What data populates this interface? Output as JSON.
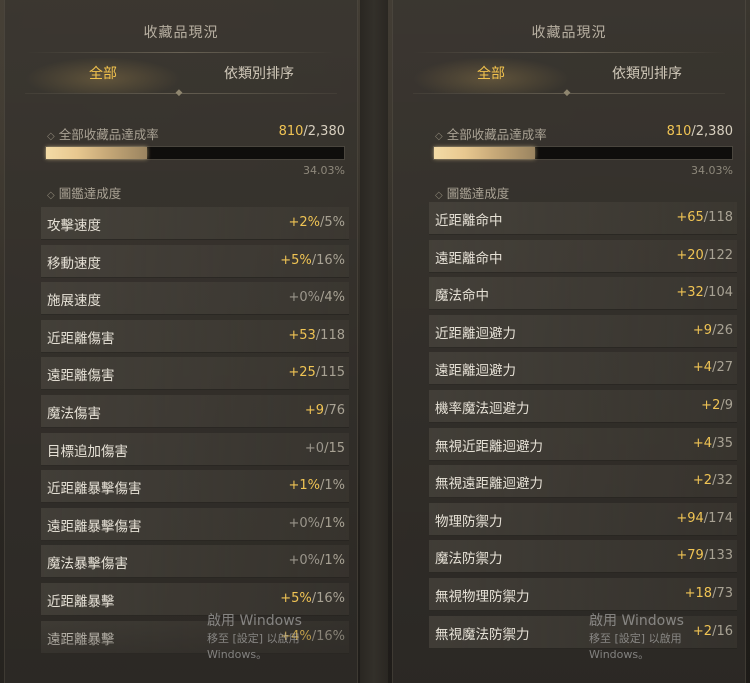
{
  "panels": [
    {
      "title": "收藏品現況",
      "tabs": [
        "全部",
        "依類別排序"
      ],
      "completion_label": "全部收藏品達成率",
      "completion_current": "810",
      "completion_total": "/2,380",
      "completion_fraction": 0.3403,
      "completion_percent": "34.03%",
      "codex_label": "圖鑑達成度",
      "rows": [
        {
          "label": "攻擊速度",
          "bonus": "+2%",
          "max": "/5%",
          "zero": false
        },
        {
          "label": "移動速度",
          "bonus": "+5%",
          "max": "/16%",
          "zero": false
        },
        {
          "label": "施展速度",
          "bonus": "+0%",
          "max": "/4%",
          "zero": true
        },
        {
          "label": "近距離傷害",
          "bonus": "+53",
          "max": "/118",
          "zero": false
        },
        {
          "label": "遠距離傷害",
          "bonus": "+25",
          "max": "/115",
          "zero": false
        },
        {
          "label": "魔法傷害",
          "bonus": "+9",
          "max": "/76",
          "zero": false
        },
        {
          "label": "目標追加傷害",
          "bonus": "+0",
          "max": "/15",
          "zero": true
        },
        {
          "label": "近距離暴擊傷害",
          "bonus": "+1%",
          "max": "/1%",
          "zero": false
        },
        {
          "label": "遠距離暴擊傷害",
          "bonus": "+0%",
          "max": "/1%",
          "zero": true
        },
        {
          "label": "魔法暴擊傷害",
          "bonus": "+0%",
          "max": "/1%",
          "zero": true
        },
        {
          "label": "近距離暴擊",
          "bonus": "+5%",
          "max": "/16%",
          "zero": false
        },
        {
          "label": "遠距離暴擊",
          "bonus": "+4%",
          "max": "/16%",
          "zero": false
        }
      ]
    },
    {
      "title": "收藏品現況",
      "tabs": [
        "全部",
        "依類別排序"
      ],
      "completion_label": "全部收藏品達成率",
      "completion_current": "810",
      "completion_total": "/2,380",
      "completion_fraction": 0.3403,
      "completion_percent": "34.03%",
      "codex_label": "圖鑑達成度",
      "rows": [
        {
          "label": "近距離命中",
          "bonus": "+65",
          "max": "/118",
          "zero": false
        },
        {
          "label": "遠距離命中",
          "bonus": "+20",
          "max": "/122",
          "zero": false
        },
        {
          "label": "魔法命中",
          "bonus": "+32",
          "max": "/104",
          "zero": false
        },
        {
          "label": "近距離迴避力",
          "bonus": "+9",
          "max": "/26",
          "zero": false
        },
        {
          "label": "遠距離迴避力",
          "bonus": "+4",
          "max": "/27",
          "zero": false
        },
        {
          "label": "機率魔法迴避力",
          "bonus": "+2",
          "max": "/9",
          "zero": false
        },
        {
          "label": "無視近距離迴避力",
          "bonus": "+4",
          "max": "/35",
          "zero": false
        },
        {
          "label": "無視遠距離迴避力",
          "bonus": "+2",
          "max": "/32",
          "zero": false
        },
        {
          "label": "物理防禦力",
          "bonus": "+94",
          "max": "/174",
          "zero": false
        },
        {
          "label": "魔法防禦力",
          "bonus": "+79",
          "max": "/133",
          "zero": false
        },
        {
          "label": "無視物理防禦力",
          "bonus": "+18",
          "max": "/73",
          "zero": false
        },
        {
          "label": "無視魔法防禦力",
          "bonus": "+2",
          "max": "/16",
          "zero": false
        }
      ]
    }
  ],
  "watermark": {
    "line1": "啟用 Windows",
    "line2": "移至 [設定] 以啟用 Windows。"
  },
  "colors": {
    "accent": "#f0c454",
    "text": "#e6e1d6",
    "muted": "#a8a294"
  }
}
